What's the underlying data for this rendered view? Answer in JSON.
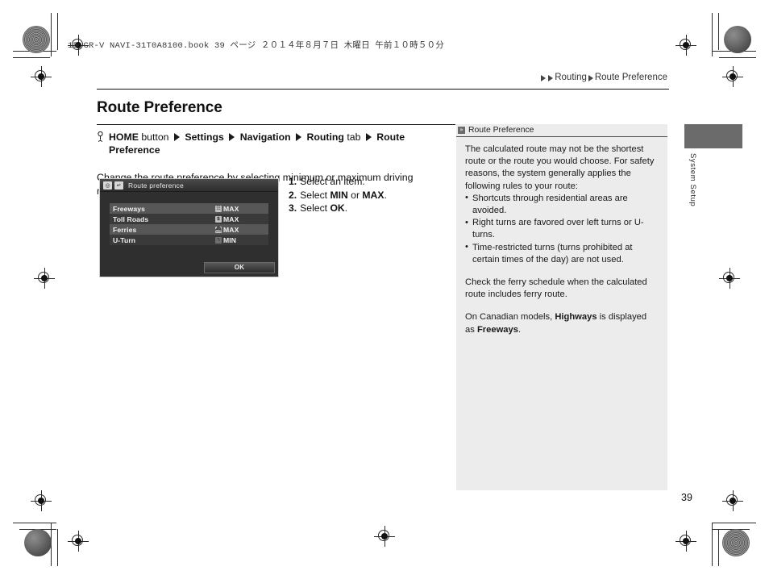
{
  "slug": "15 CR-V NAVI-31T0A8100.book   39 ページ   ２０１４年８月７日   木曜日   午前１０時５０分",
  "running_header": {
    "section": "Routing",
    "topic": "Route Preference"
  },
  "page": {
    "title": "Route Preference",
    "number": "39"
  },
  "path": {
    "home_label": "HOME",
    "button_word": "button",
    "settings": "Settings",
    "navigation": "Navigation",
    "routing": "Routing",
    "tab_word": "tab",
    "route_preference": "Route Preference"
  },
  "intro": "Change the route preference by selecting minimum or maximum driving methods.",
  "nav_screen": {
    "title": "Route preference",
    "title_icons": [
      "target-icon",
      "return-arrow-icon"
    ],
    "rows": [
      {
        "label": "Freeways",
        "badge": "☷",
        "value": "MAX",
        "shaded": true
      },
      {
        "label": "Toll Roads",
        "badge": "$",
        "value": "MAX",
        "shaded": false
      },
      {
        "label": "Ferries",
        "badge": "⛴",
        "value": "MAX",
        "shaded": true
      },
      {
        "label": "U-Turn",
        "badge": "↰",
        "value": "MIN",
        "shaded": false
      }
    ],
    "ok_label": "OK"
  },
  "steps": [
    {
      "num": "1.",
      "pre": "Select an item.",
      "bold": "",
      "post": ""
    },
    {
      "num": "2.",
      "pre": "Select ",
      "bold": "MIN",
      "mid": " or ",
      "bold2": "MAX",
      "post": "."
    },
    {
      "num": "3.",
      "pre": "Select ",
      "bold": "OK",
      "post": "."
    }
  ],
  "sidebar": {
    "heading": "Route Preference",
    "heading_icon": "chevron-double-right-icon",
    "paragraph1": "The calculated route may not be the shortest route or the route you would choose. For safety reasons, the system generally applies the following rules to your route:",
    "bullets": [
      "Shortcuts through residential areas are avoided.",
      "Right turns are favored over left turns or U-turns.",
      "Time-restricted turns (turns prohibited at certain times of the day) are not used."
    ],
    "paragraph2": "Check the ferry schedule when the calculated route includes ferry route.",
    "paragraph3_pre": "On Canadian models, ",
    "paragraph3_bold": "Highways",
    "paragraph3_mid": " is displayed as ",
    "paragraph3_bold2": "Freeways",
    "paragraph3_post": "."
  },
  "thumb_tab": {
    "label": "System Setup"
  }
}
